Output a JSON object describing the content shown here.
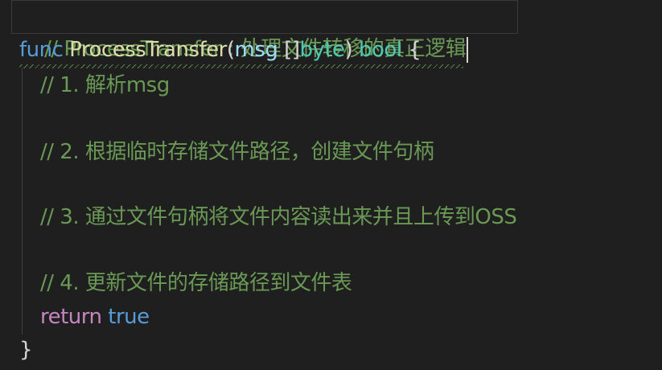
{
  "lines": {
    "l1": {
      "comment": "// ProcessTransfer : 处理文件转移的真正逻辑"
    },
    "l2": {
      "kw": "func",
      "name": "ProcessTransfer",
      "open": "(",
      "param": "msg",
      "brackets": "[]",
      "ptype": "byte",
      "close": ")",
      "ret": "bool",
      "brace": "{"
    },
    "l3": {
      "comment": "// 1. 解析msg"
    },
    "l5": {
      "comment": "// 2. 根据临时存储文件路径，创建文件句柄"
    },
    "l7": {
      "comment": "// 3. 通过文件句柄将文件内容读出来并且上传到OSS"
    },
    "l9": {
      "comment": "// 4. 更新文件的存储路径到文件表"
    },
    "l10": {
      "kw": "return",
      "val": "true"
    },
    "l11": {
      "brace": "}"
    }
  },
  "colors": {
    "background": "#1f1f1f",
    "comment": "#6a9955",
    "keyword": "#569cd6",
    "function": "#dcdcaa",
    "param": "#9cdcfe",
    "type": "#4ec9b0",
    "control": "#c586c0"
  }
}
